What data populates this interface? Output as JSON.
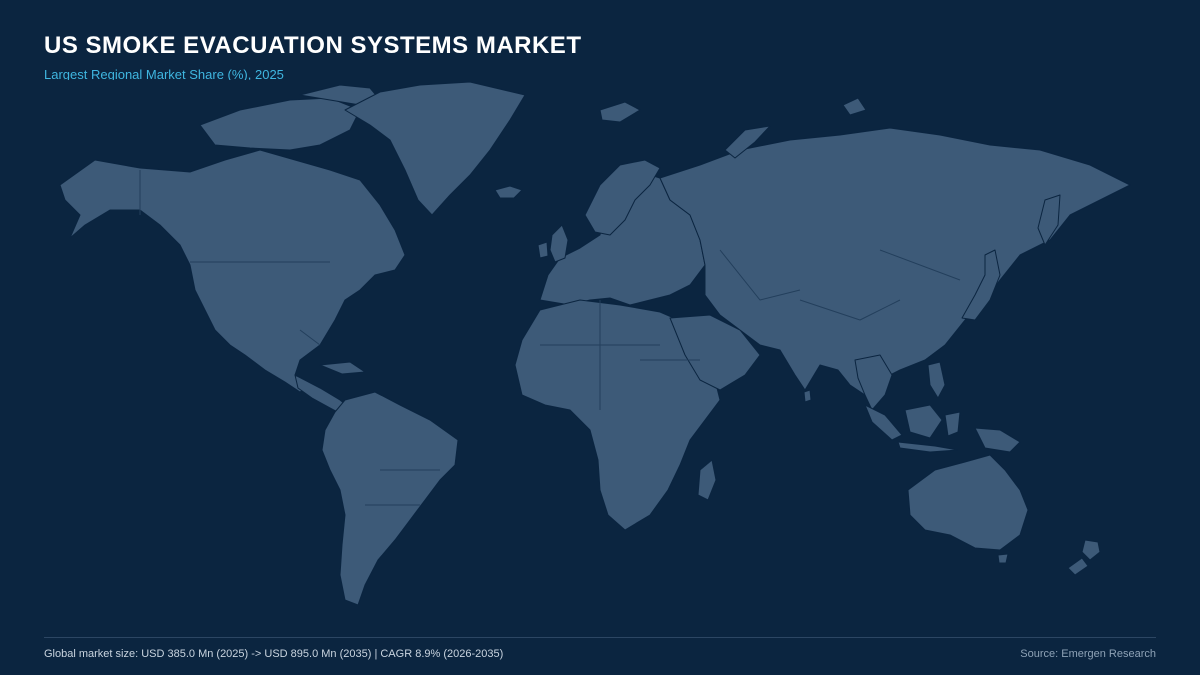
{
  "header": {
    "title": "US SMOKE EVACUATION SYSTEMS MARKET",
    "subtitle": "Largest Regional Market Share (%), 2025"
  },
  "footer": {
    "summary": "Global market size: USD 385.0 Mn (2025) -> USD 895.0 Mn (2035) | CAGR 8.9% (2026-2035)",
    "source": "Source: Emergen Research"
  },
  "colors": {
    "background": "#0b2540",
    "land": "#3d5a78",
    "title": "#ffffff",
    "subtitle": "#3fb6e0"
  }
}
